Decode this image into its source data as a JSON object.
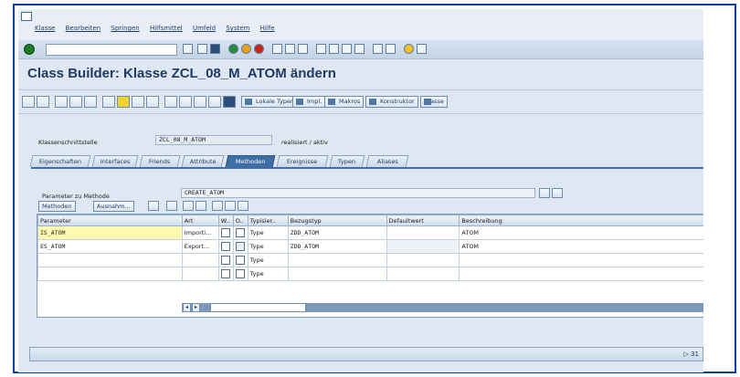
{
  "menu": [
    "Klasse",
    "Bearbeiten",
    "Springen",
    "Hilfsmittel",
    "Umfeld",
    "System",
    "Hilfe"
  ],
  "title": "Class Builder: Klasse ZCL_08_M_ATOM ändern",
  "toolbar": {
    "lokale_typen": "Lokale Typen",
    "impl": "Impl.",
    "makros": "Makros",
    "konstruktor": "Konstruktor",
    "klasse": "Klasse"
  },
  "interface": {
    "label": "Klassenschnittstelle",
    "value": "ZCL_08_M_ATOM",
    "status": "realisiert / aktiv"
  },
  "tabs": [
    "Eigenschaften",
    "Interfaces",
    "Friends",
    "Attribute",
    "Methoden",
    "Ereignisse",
    "Typen",
    "Aliases"
  ],
  "active_tab": "Methoden",
  "params": {
    "label": "Parameter zu Methode",
    "method": "CREATE_ATOM",
    "methoden_button": "Methoden",
    "ausnahmen_button": "Ausnahm..."
  },
  "table": {
    "headers": [
      "Parameter",
      "Art",
      "W..",
      "O..",
      "Typisier..",
      "Bezugstyp",
      "Defaultwert",
      "Beschreibung"
    ],
    "rows": [
      {
        "parameter": "IS_ATOM",
        "art": "Importi...",
        "typisierung": "Type",
        "bezugstyp": "ZDD_ATOM",
        "default": "",
        "beschreibung": "ATOM"
      },
      {
        "parameter": "ES_ATOM",
        "art": "Export...",
        "typisierung": "Type",
        "bezugstyp": "ZDD_ATOM",
        "default": "",
        "beschreibung": "ATOM"
      },
      {
        "parameter": "",
        "art": "",
        "typisierung": "Type",
        "bezugstyp": "",
        "default": "",
        "beschreibung": ""
      },
      {
        "parameter": "",
        "art": "",
        "typisierung": "Type",
        "bezugstyp": "",
        "default": "",
        "beschreibung": ""
      }
    ]
  },
  "status": {
    "right": "▷ 31"
  },
  "colors": {
    "accent": "#3f6ea4",
    "title": "#1f3b64",
    "frame": "#0b3fa0"
  },
  "icons": [
    "system-menu-icon",
    "ok-icon",
    "save-icon",
    "back-icon",
    "exit-icon",
    "cancel-icon",
    "print-icon",
    "find-icon",
    "help-icon"
  ]
}
